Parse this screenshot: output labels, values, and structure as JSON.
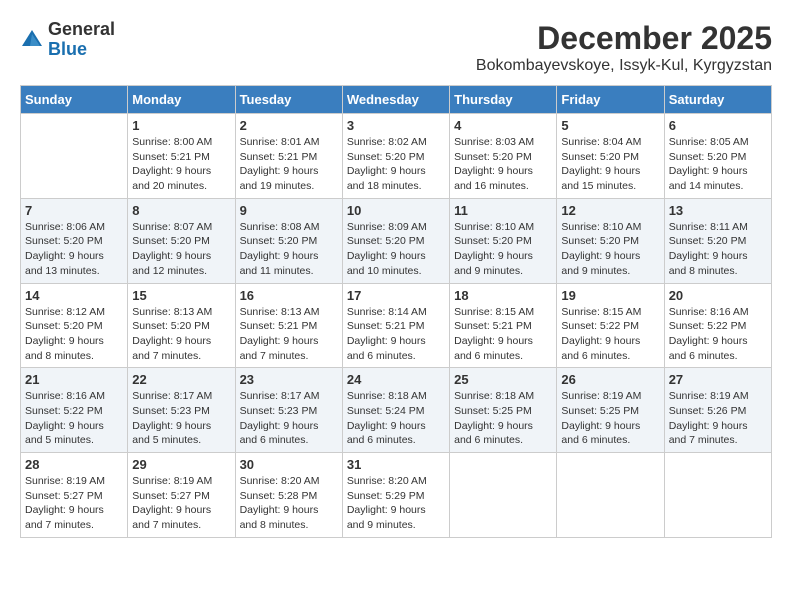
{
  "header": {
    "logo_general": "General",
    "logo_blue": "Blue",
    "month": "December 2025",
    "location": "Bokombayevskoye, Issyk-Kul, Kyrgyzstan"
  },
  "days_of_week": [
    "Sunday",
    "Monday",
    "Tuesday",
    "Wednesday",
    "Thursday",
    "Friday",
    "Saturday"
  ],
  "weeks": [
    [
      {
        "day": "",
        "info": ""
      },
      {
        "day": "1",
        "info": "Sunrise: 8:00 AM\nSunset: 5:21 PM\nDaylight: 9 hours\nand 20 minutes."
      },
      {
        "day": "2",
        "info": "Sunrise: 8:01 AM\nSunset: 5:21 PM\nDaylight: 9 hours\nand 19 minutes."
      },
      {
        "day": "3",
        "info": "Sunrise: 8:02 AM\nSunset: 5:20 PM\nDaylight: 9 hours\nand 18 minutes."
      },
      {
        "day": "4",
        "info": "Sunrise: 8:03 AM\nSunset: 5:20 PM\nDaylight: 9 hours\nand 16 minutes."
      },
      {
        "day": "5",
        "info": "Sunrise: 8:04 AM\nSunset: 5:20 PM\nDaylight: 9 hours\nand 15 minutes."
      },
      {
        "day": "6",
        "info": "Sunrise: 8:05 AM\nSunset: 5:20 PM\nDaylight: 9 hours\nand 14 minutes."
      }
    ],
    [
      {
        "day": "7",
        "info": "Sunrise: 8:06 AM\nSunset: 5:20 PM\nDaylight: 9 hours\nand 13 minutes."
      },
      {
        "day": "8",
        "info": "Sunrise: 8:07 AM\nSunset: 5:20 PM\nDaylight: 9 hours\nand 12 minutes."
      },
      {
        "day": "9",
        "info": "Sunrise: 8:08 AM\nSunset: 5:20 PM\nDaylight: 9 hours\nand 11 minutes."
      },
      {
        "day": "10",
        "info": "Sunrise: 8:09 AM\nSunset: 5:20 PM\nDaylight: 9 hours\nand 10 minutes."
      },
      {
        "day": "11",
        "info": "Sunrise: 8:10 AM\nSunset: 5:20 PM\nDaylight: 9 hours\nand 9 minutes."
      },
      {
        "day": "12",
        "info": "Sunrise: 8:10 AM\nSunset: 5:20 PM\nDaylight: 9 hours\nand 9 minutes."
      },
      {
        "day": "13",
        "info": "Sunrise: 8:11 AM\nSunset: 5:20 PM\nDaylight: 9 hours\nand 8 minutes."
      }
    ],
    [
      {
        "day": "14",
        "info": "Sunrise: 8:12 AM\nSunset: 5:20 PM\nDaylight: 9 hours\nand 8 minutes."
      },
      {
        "day": "15",
        "info": "Sunrise: 8:13 AM\nSunset: 5:20 PM\nDaylight: 9 hours\nand 7 minutes."
      },
      {
        "day": "16",
        "info": "Sunrise: 8:13 AM\nSunset: 5:21 PM\nDaylight: 9 hours\nand 7 minutes."
      },
      {
        "day": "17",
        "info": "Sunrise: 8:14 AM\nSunset: 5:21 PM\nDaylight: 9 hours\nand 6 minutes."
      },
      {
        "day": "18",
        "info": "Sunrise: 8:15 AM\nSunset: 5:21 PM\nDaylight: 9 hours\nand 6 minutes."
      },
      {
        "day": "19",
        "info": "Sunrise: 8:15 AM\nSunset: 5:22 PM\nDaylight: 9 hours\nand 6 minutes."
      },
      {
        "day": "20",
        "info": "Sunrise: 8:16 AM\nSunset: 5:22 PM\nDaylight: 9 hours\nand 6 minutes."
      }
    ],
    [
      {
        "day": "21",
        "info": "Sunrise: 8:16 AM\nSunset: 5:22 PM\nDaylight: 9 hours\nand 5 minutes."
      },
      {
        "day": "22",
        "info": "Sunrise: 8:17 AM\nSunset: 5:23 PM\nDaylight: 9 hours\nand 5 minutes."
      },
      {
        "day": "23",
        "info": "Sunrise: 8:17 AM\nSunset: 5:23 PM\nDaylight: 9 hours\nand 6 minutes."
      },
      {
        "day": "24",
        "info": "Sunrise: 8:18 AM\nSunset: 5:24 PM\nDaylight: 9 hours\nand 6 minutes."
      },
      {
        "day": "25",
        "info": "Sunrise: 8:18 AM\nSunset: 5:25 PM\nDaylight: 9 hours\nand 6 minutes."
      },
      {
        "day": "26",
        "info": "Sunrise: 8:19 AM\nSunset: 5:25 PM\nDaylight: 9 hours\nand 6 minutes."
      },
      {
        "day": "27",
        "info": "Sunrise: 8:19 AM\nSunset: 5:26 PM\nDaylight: 9 hours\nand 7 minutes."
      }
    ],
    [
      {
        "day": "28",
        "info": "Sunrise: 8:19 AM\nSunset: 5:27 PM\nDaylight: 9 hours\nand 7 minutes."
      },
      {
        "day": "29",
        "info": "Sunrise: 8:19 AM\nSunset: 5:27 PM\nDaylight: 9 hours\nand 7 minutes."
      },
      {
        "day": "30",
        "info": "Sunrise: 8:20 AM\nSunset: 5:28 PM\nDaylight: 9 hours\nand 8 minutes."
      },
      {
        "day": "31",
        "info": "Sunrise: 8:20 AM\nSunset: 5:29 PM\nDaylight: 9 hours\nand 9 minutes."
      },
      {
        "day": "",
        "info": ""
      },
      {
        "day": "",
        "info": ""
      },
      {
        "day": "",
        "info": ""
      }
    ]
  ]
}
